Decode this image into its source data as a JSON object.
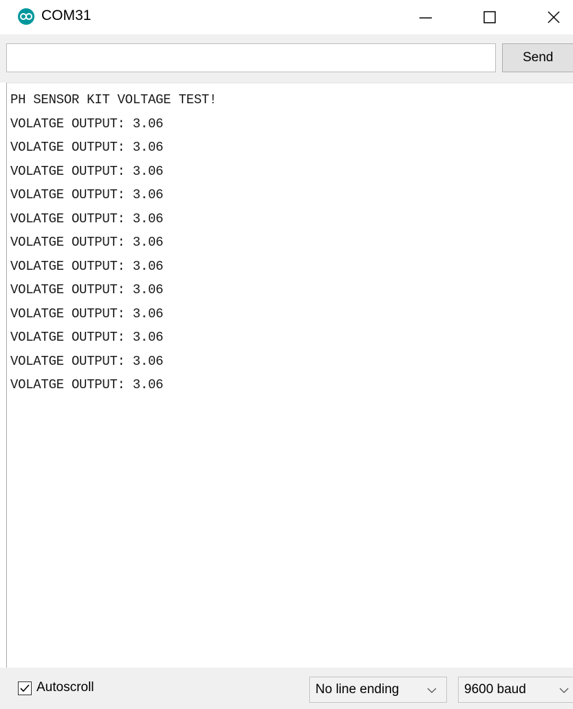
{
  "window": {
    "title": "COM31",
    "app_icon": "arduino-infinity-icon",
    "controls": [
      "minimize-icon",
      "maximize-icon",
      "close-icon"
    ]
  },
  "send_bar": {
    "input_value": "",
    "send_label": "Send"
  },
  "output": {
    "lines": [
      "PH SENSOR KIT VOLTAGE TEST!",
      "VOLATGE OUTPUT: 3.06",
      "VOLATGE OUTPUT: 3.06",
      "VOLATGE OUTPUT: 3.06",
      "VOLATGE OUTPUT: 3.06",
      "VOLATGE OUTPUT: 3.06",
      "VOLATGE OUTPUT: 3.06",
      "VOLATGE OUTPUT: 3.06",
      "VOLATGE OUTPUT: 3.06",
      "VOLATGE OUTPUT: 3.06",
      "VOLATGE OUTPUT: 3.06",
      "VOLATGE OUTPUT: 3.06",
      "VOLATGE OUTPUT: 3.06"
    ]
  },
  "status_bar": {
    "autoscroll_label": "Autoscroll",
    "autoscroll_checked": true,
    "line_ending": "No line ending",
    "baud": "9600 baud"
  },
  "colors": {
    "app_icon": "#00979c",
    "panel": "#f0f0f0"
  }
}
